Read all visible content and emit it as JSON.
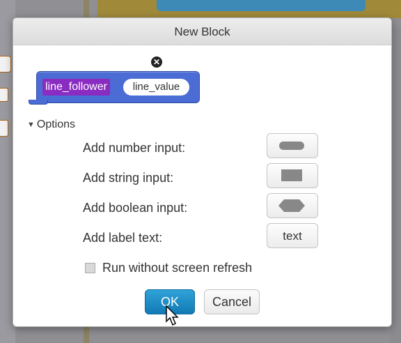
{
  "dialog": {
    "title": "New Block",
    "block_preview": {
      "name": "line_follower",
      "input": "line_value",
      "block_color": "#4a6cd4",
      "name_color": "#8a2bc2"
    },
    "options_label": "Options",
    "options": [
      {
        "label": "Add number input:",
        "button": "number-input-shape"
      },
      {
        "label": "Add string input:",
        "button": "string-input-shape"
      },
      {
        "label": "Add boolean input:",
        "button": "boolean-input-shape"
      },
      {
        "label": "Add label text:",
        "button_text": "text"
      }
    ],
    "checkbox_label": "Run without screen refresh",
    "checkbox_checked": false,
    "ok_label": "OK",
    "cancel_label": "Cancel",
    "ok_color": "#1b8cc6"
  }
}
